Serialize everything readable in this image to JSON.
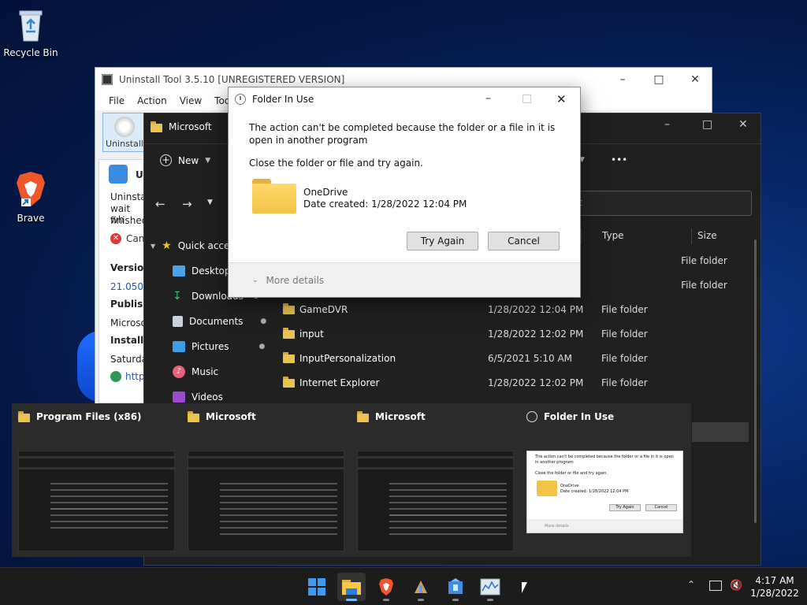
{
  "desktop": {
    "icons": [
      {
        "label": "Recycle Bin",
        "icon": "recycle-bin-icon"
      },
      {
        "label": "Brave",
        "icon": "brave-icon"
      }
    ]
  },
  "uninstall_tool": {
    "title": "Uninstall Tool 3.5.10 [UNREGISTERED VERSION]",
    "menu": [
      "File",
      "Action",
      "View",
      "Tools"
    ],
    "toolbar_label": "Uninstall",
    "panel": {
      "name_partial": "U",
      "msg": [
        "Uninstall",
        "wait wh",
        "finished"
      ],
      "cancel": "Can",
      "version_label": "Version",
      "version_value": "21.050.",
      "publisher_label": "Publishe",
      "publisher_value": "Microso",
      "installed_label": "Installed",
      "installed_value": "Saturday",
      "link": "http"
    }
  },
  "explorer": {
    "title": "Microsoft",
    "new_label": "New",
    "more": "•••",
    "search_placeholder": "t",
    "columns": {
      "type": "Type",
      "size": "Size"
    },
    "nav": [
      {
        "label": "Quick acce",
        "icon": "star-icon"
      },
      {
        "label": "Desktop",
        "icon": "desktop-icon"
      },
      {
        "label": "Downloads",
        "icon": "download-icon"
      },
      {
        "label": "Documents",
        "icon": "documents-icon"
      },
      {
        "label": "Pictures",
        "icon": "pictures-icon"
      },
      {
        "label": "Music",
        "icon": "music-icon"
      },
      {
        "label": "Videos",
        "icon": "videos-icon"
      }
    ],
    "rows": [
      {
        "name": "",
        "date": "",
        "type": "File folder"
      },
      {
        "name": "",
        "date": "",
        "type": "File folder"
      },
      {
        "name": "GameDVR",
        "date": "1/28/2022 12:04 PM",
        "type": "File folder"
      },
      {
        "name": "input",
        "date": "1/28/2022 12:02 PM",
        "type": "File folder"
      },
      {
        "name": "InputPersonalization",
        "date": "6/5/2021 5:10 AM",
        "type": "File folder"
      },
      {
        "name": "Internet Explorer",
        "date": "1/28/2022 12:02 PM",
        "type": "File folder"
      }
    ]
  },
  "dialog": {
    "title": "Folder In Use",
    "message": "The action can't be completed because the folder or a file in it is open in another program",
    "instruction": "Close the folder or file and try again.",
    "item_name": "OneDrive",
    "item_date": "Date created: 1/28/2022 12:04 PM",
    "try_again": "Try Again",
    "cancel": "Cancel",
    "more_details": "More details"
  },
  "taskview": [
    {
      "title": "Program Files (x86)",
      "icon": "folder-icon"
    },
    {
      "title": "Microsoft",
      "icon": "folder-icon"
    },
    {
      "title": "Microsoft",
      "icon": "folder-icon"
    },
    {
      "title": "Folder In Use",
      "icon": "clock-icon"
    }
  ],
  "thumb_dialog": {
    "message": "The action can't be completed because the folder or a file in it is open in another program",
    "instruction": "Close the folder or file and try again.",
    "item_name": "OneDrive",
    "item_date": "Date created: 1/28/2022 12:04 PM",
    "try_again": "Try Again",
    "cancel": "Cancel",
    "more_details": "More details"
  },
  "taskbar": {
    "apps": [
      "start-icon",
      "file-explorer-icon",
      "brave-icon",
      "installer-icon",
      "uninstall-tool-icon",
      "task-manager-icon"
    ],
    "time": "4:17 AM",
    "date": "1/28/2022"
  }
}
